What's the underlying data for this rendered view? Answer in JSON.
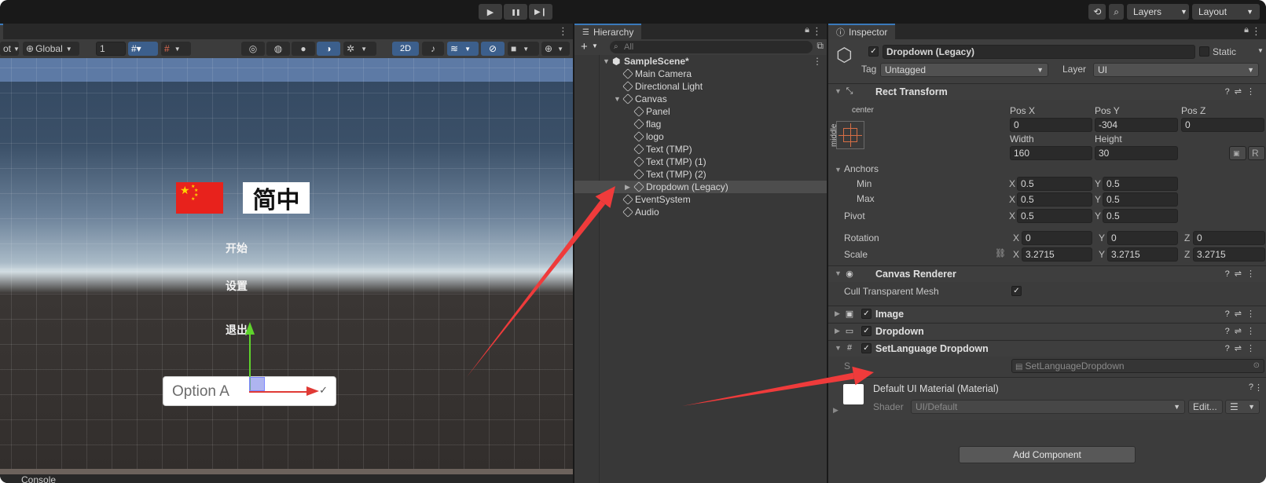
{
  "topbar": {
    "play": "▶",
    "pause": "❚❚",
    "step": "▶❙",
    "layers_label": "Layers",
    "layout_label": "Layout"
  },
  "scene": {
    "toolbar": {
      "pivot_partial": "ot",
      "global_label": "Global",
      "grid_size": "1",
      "mode_2d": "2D"
    },
    "logo_text": "简中",
    "menu": [
      "开始",
      "设置",
      "退出"
    ],
    "dropdown_label": "Option A",
    "console_tab": "Console"
  },
  "hierarchy": {
    "tab": "Hierarchy",
    "search_placeholder": "All",
    "items": [
      {
        "label": "SampleScene*"
      },
      {
        "label": "Main Camera"
      },
      {
        "label": "Directional Light"
      },
      {
        "label": "Canvas"
      },
      {
        "label": "Panel"
      },
      {
        "label": "flag"
      },
      {
        "label": "logo"
      },
      {
        "label": "Text (TMP)"
      },
      {
        "label": "Text (TMP) (1)"
      },
      {
        "label": "Text (TMP) (2)"
      },
      {
        "label": "Dropdown (Legacy)"
      },
      {
        "label": "EventSystem"
      },
      {
        "label": "Audio"
      }
    ]
  },
  "inspector": {
    "tab": "Inspector",
    "object_name": "Dropdown (Legacy)",
    "static_label": "Static",
    "tag_label": "Tag",
    "tag_value": "Untagged",
    "layer_label": "Layer",
    "layer_value": "UI",
    "rect_transform": {
      "title": "Rect Transform",
      "anchor_h": "center",
      "anchor_v": "middle",
      "pos_x_label": "Pos X",
      "pos_x": "0",
      "pos_y_label": "Pos Y",
      "pos_y": "-304",
      "pos_z_label": "Pos Z",
      "pos_z": "0",
      "width_label": "Width",
      "width": "160",
      "height_label": "Height",
      "height": "30",
      "r_label": "R",
      "anchors_label": "Anchors",
      "min_label": "Min",
      "min_x": "0.5",
      "min_y": "0.5",
      "max_label": "Max",
      "max_x": "0.5",
      "max_y": "0.5",
      "pivot_label": "Pivot",
      "pivot_x": "0.5",
      "pivot_y": "0.5",
      "rotation_label": "Rotation",
      "rot_x": "0",
      "rot_y": "0",
      "rot_z": "0",
      "scale_label": "Scale",
      "scale_x": "3.2715",
      "scale_y": "3.2715",
      "scale_z": "3.2715"
    },
    "canvas_renderer": {
      "title": "Canvas Renderer",
      "cull_label": "Cull Transparent Mesh"
    },
    "image_title": "Image",
    "dropdown_title": "Dropdown",
    "setlang": {
      "title": "SetLanguage Dropdown",
      "script_partial": "S",
      "script_value": "SetLanguageDropdown"
    },
    "material": {
      "title": "Default UI Material (Material)",
      "shader_label": "Shader",
      "shader_value": "UI/Default",
      "edit_label": "Edit..."
    },
    "add_component": "Add Component"
  },
  "annotation_color": "#ef3b3b"
}
